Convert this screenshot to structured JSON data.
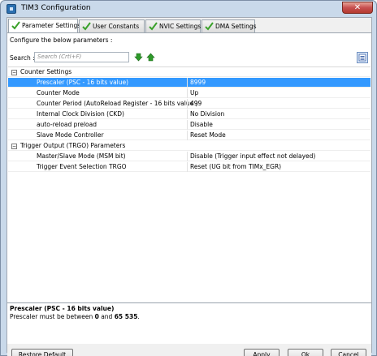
{
  "window": {
    "title": "TIM3 Configuration",
    "close_glyph": "✕"
  },
  "tabs": [
    {
      "label": "Parameter Settings",
      "active": true
    },
    {
      "label": "User Constants",
      "active": false
    },
    {
      "label": "NVIC Settings",
      "active": false
    },
    {
      "label": "DMA Settings",
      "active": false
    }
  ],
  "panel": {
    "configure_label": "Configure the below parameters :",
    "search_label": "Search :",
    "search_placeholder": "Search (Crtl+F)"
  },
  "groups": [
    {
      "label": "Counter Settings",
      "expander": "−",
      "rows": [
        {
          "name": "Prescaler (PSC - 16 bits value)",
          "value": "8999",
          "selected": true
        },
        {
          "name": "Counter Mode",
          "value": "Up"
        },
        {
          "name": "Counter Period (AutoReload Register - 16 bits value )",
          "value": "499"
        },
        {
          "name": "Internal Clock Division (CKD)",
          "value": "No Division"
        },
        {
          "name": "auto-reload preload",
          "value": "Disable"
        },
        {
          "name": "Slave Mode Controller",
          "value": "Reset Mode"
        }
      ]
    },
    {
      "label": "Trigger Output (TRGO) Parameters",
      "expander": "−",
      "rows": [
        {
          "name": "Master/Slave Mode (MSM bit)",
          "value": "Disable (Trigger input effect not delayed)"
        },
        {
          "name": "Trigger Event Selection TRGO",
          "value": "Reset (UG bit from TIMx_EGR)"
        }
      ]
    }
  ],
  "description": {
    "title": "Prescaler (PSC - 16 bits value)",
    "text_prefix": "Prescaler must be between ",
    "min": "0",
    "text_mid": " and ",
    "max": "65 535",
    "text_suffix": "."
  },
  "buttons": {
    "restore_default": "Restore Default",
    "apply": "Apply",
    "ok": "Ok",
    "cancel": "Cancel"
  },
  "colors": {
    "selection": "#3399ff",
    "check_green": "#3aa12a",
    "arrow_green": "#2e9a2a"
  }
}
